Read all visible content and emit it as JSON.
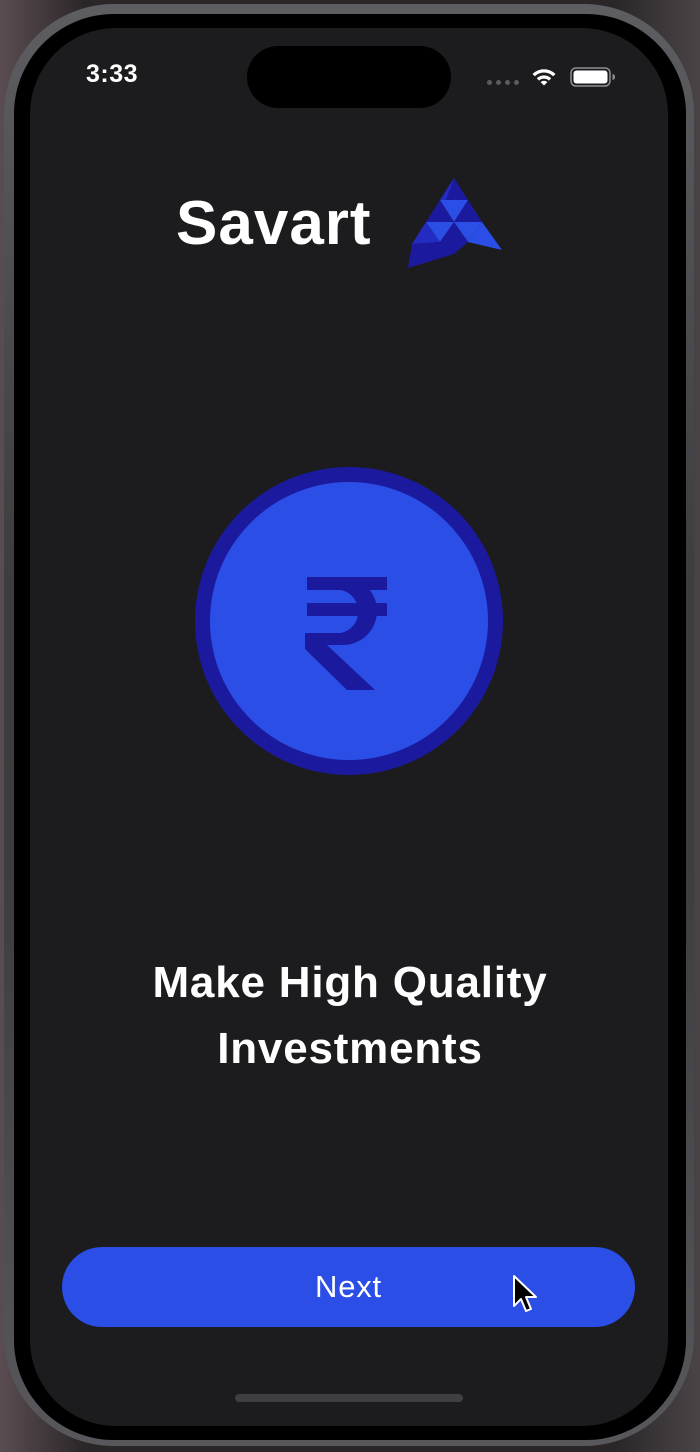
{
  "status_bar": {
    "time": "3:33",
    "icons": [
      "signal-dots-icon",
      "wifi-icon",
      "battery-icon"
    ]
  },
  "brand": {
    "name": "Savart",
    "logo_icon": "savart-logo-icon"
  },
  "illustration": {
    "icon": "rupee-coin-icon",
    "symbol": "₹"
  },
  "onboarding": {
    "headline_line1": "Make High Quality",
    "headline_line2": "Investments"
  },
  "actions": {
    "next_label": "Next"
  },
  "colors": {
    "background": "#1c1c1e",
    "accent": "#2a4ee6",
    "coin_face": "#2a4ee6",
    "coin_rim": "#1b1a9e",
    "rupee_symbol": "#1b1a9e",
    "text": "#ffffff"
  }
}
